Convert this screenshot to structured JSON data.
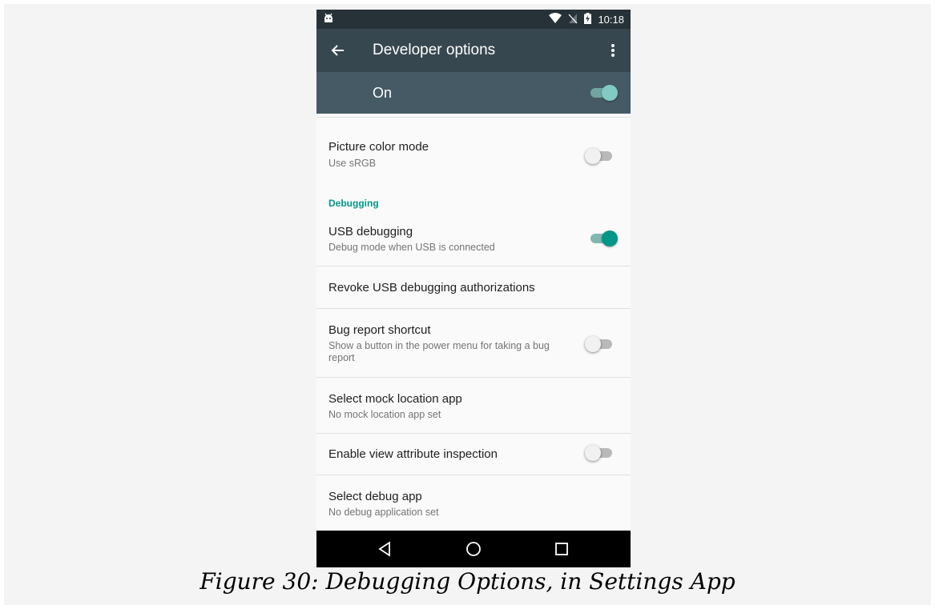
{
  "status_bar": {
    "time": "10:18",
    "icons": [
      "android-debug-icon",
      "wifi-icon",
      "no-sim-icon",
      "battery-charging-icon"
    ]
  },
  "toolbar": {
    "title": "Developer options",
    "back_icon": "arrow-back-icon",
    "menu_icon": "more-vert-icon"
  },
  "master_switch": {
    "label": "On",
    "checked": true
  },
  "list": {
    "picture_color_mode": {
      "title": "Picture color mode",
      "summary": "Use sRGB",
      "checked": false
    },
    "debugging_header": "Debugging",
    "usb_debugging": {
      "title": "USB debugging",
      "summary": "Debug mode when USB is connected",
      "checked": true
    },
    "revoke_usb": {
      "title": "Revoke USB debugging authorizations"
    },
    "bug_report": {
      "title": "Bug report shortcut",
      "summary": "Show a button in the power menu for taking a bug report",
      "checked": false
    },
    "mock_location": {
      "title": "Select mock location app",
      "summary": "No mock location app set"
    },
    "view_attribute": {
      "title": "Enable view attribute inspection",
      "checked": false
    },
    "debug_app": {
      "title": "Select debug app",
      "summary": "No debug application set"
    }
  },
  "nav_bar": {
    "icons": [
      "back-triangle-icon",
      "home-circle-icon",
      "recents-square-icon"
    ]
  },
  "caption": "Figure 30: Debugging Options, in Settings App",
  "colors": {
    "status_bar": "#263238",
    "toolbar": "#37474f",
    "master_switch_bar": "#455a64",
    "accent": "#009688"
  }
}
